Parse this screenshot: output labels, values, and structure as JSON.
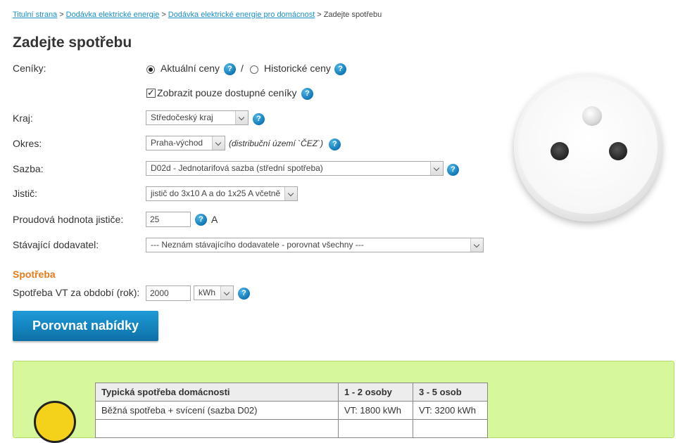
{
  "breadcrumb": {
    "items": [
      "Titulní strana",
      "Dodávka elektrické energie",
      "Dodávka elektrické energie pro domácnost"
    ],
    "current": "Zadejte spotřebu",
    "separator": ">"
  },
  "page_title": "Zadejte spotřebu",
  "form": {
    "ceniky_label": "Ceníky:",
    "radio_current": "Aktuální ceny",
    "radio_separator": "/",
    "radio_historic": "Historické ceny",
    "radio_selected": "current",
    "checkbox_label": "Zobrazit pouze dostupné ceníky",
    "checkbox_checked": true,
    "kraj_label": "Kraj:",
    "kraj_value": "Středočeský kraj",
    "okres_label": "Okres:",
    "okres_value": "Praha-východ",
    "okres_note": "(distribuční území `ČEZ`)",
    "sazba_label": "Sazba:",
    "sazba_value": "D02d - Jednotarifová sazba (střední spotřeba)",
    "jistic_label": "Jistič:",
    "jistic_value": "jistič do 3x10 A a do 1x25 A včetně",
    "proud_label": "Proudová hodnota jističe:",
    "proud_value": "25",
    "proud_unit": "A",
    "dodavatel_label": "Stávající dodavatel:",
    "dodavatel_value": "--- Neznám stávajícího dodavatele - porovnat všechny ---"
  },
  "spotreba": {
    "section_title": "Spotřeba",
    "vt_label": "Spotřeba VT za období (rok):",
    "vt_value": "2000",
    "unit_value": "kWh"
  },
  "compare_button": "Porovnat nabídky",
  "help_glyph": "?",
  "info_table": {
    "headers": [
      "Typická spotřeba domácnosti",
      "1 - 2 osoby",
      "3 - 5 osob"
    ],
    "rows": [
      [
        "Běžná spotřeba + svícení (sazba D02)",
        "VT: 1800 kWh",
        "VT: 3200 kWh"
      ]
    ]
  },
  "colors": {
    "link": "#1a8fc9",
    "accent_orange": "#e87a1a",
    "button_blue": "#1585c0",
    "help_blue": "#1278b6",
    "green_panel": "#d6f79a"
  },
  "icons": [
    "help-icon",
    "socket-illustration",
    "smiley-icon"
  ]
}
